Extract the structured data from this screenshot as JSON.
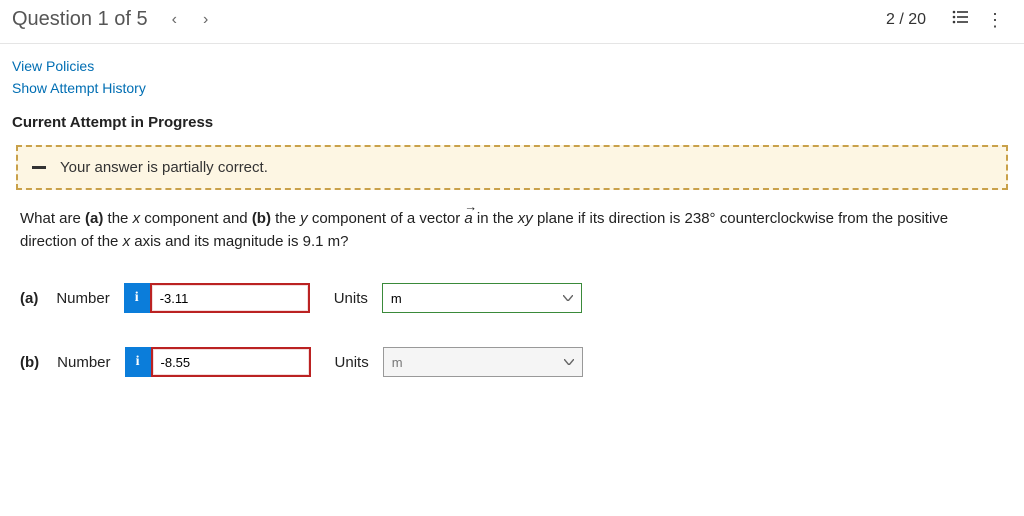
{
  "header": {
    "question_label": "Question 1 of 5",
    "counter": "2 / 20"
  },
  "links": {
    "view_policies": "View Policies",
    "show_history": "Show Attempt History"
  },
  "section_title": "Current Attempt in Progress",
  "alert": {
    "message": "Your answer is partially correct."
  },
  "question": {
    "prefix": "What are ",
    "a_bold": "(a)",
    "a_text": " the ",
    "x_ital": "x",
    "mid1": " component and ",
    "b_bold": "(b)",
    "b_text": " the ",
    "y_ital": "y",
    "mid2": " component of a vector ",
    "vec": "a",
    "mid3": " in the ",
    "xy_ital": "xy",
    "tail": " plane if its direction is 238° counterclockwise from the positive direction of the ",
    "x2_ital": "x",
    "end": " axis and its magnitude is 9.1 m?"
  },
  "parts": {
    "a": {
      "part": "(a)",
      "num_label": "Number",
      "info": "i",
      "value": "-3.11",
      "units_label": "Units",
      "units_value": "m"
    },
    "b": {
      "part": "(b)",
      "num_label": "Number",
      "info": "i",
      "value": "-8.55",
      "units_label": "Units",
      "units_value": "m"
    }
  }
}
